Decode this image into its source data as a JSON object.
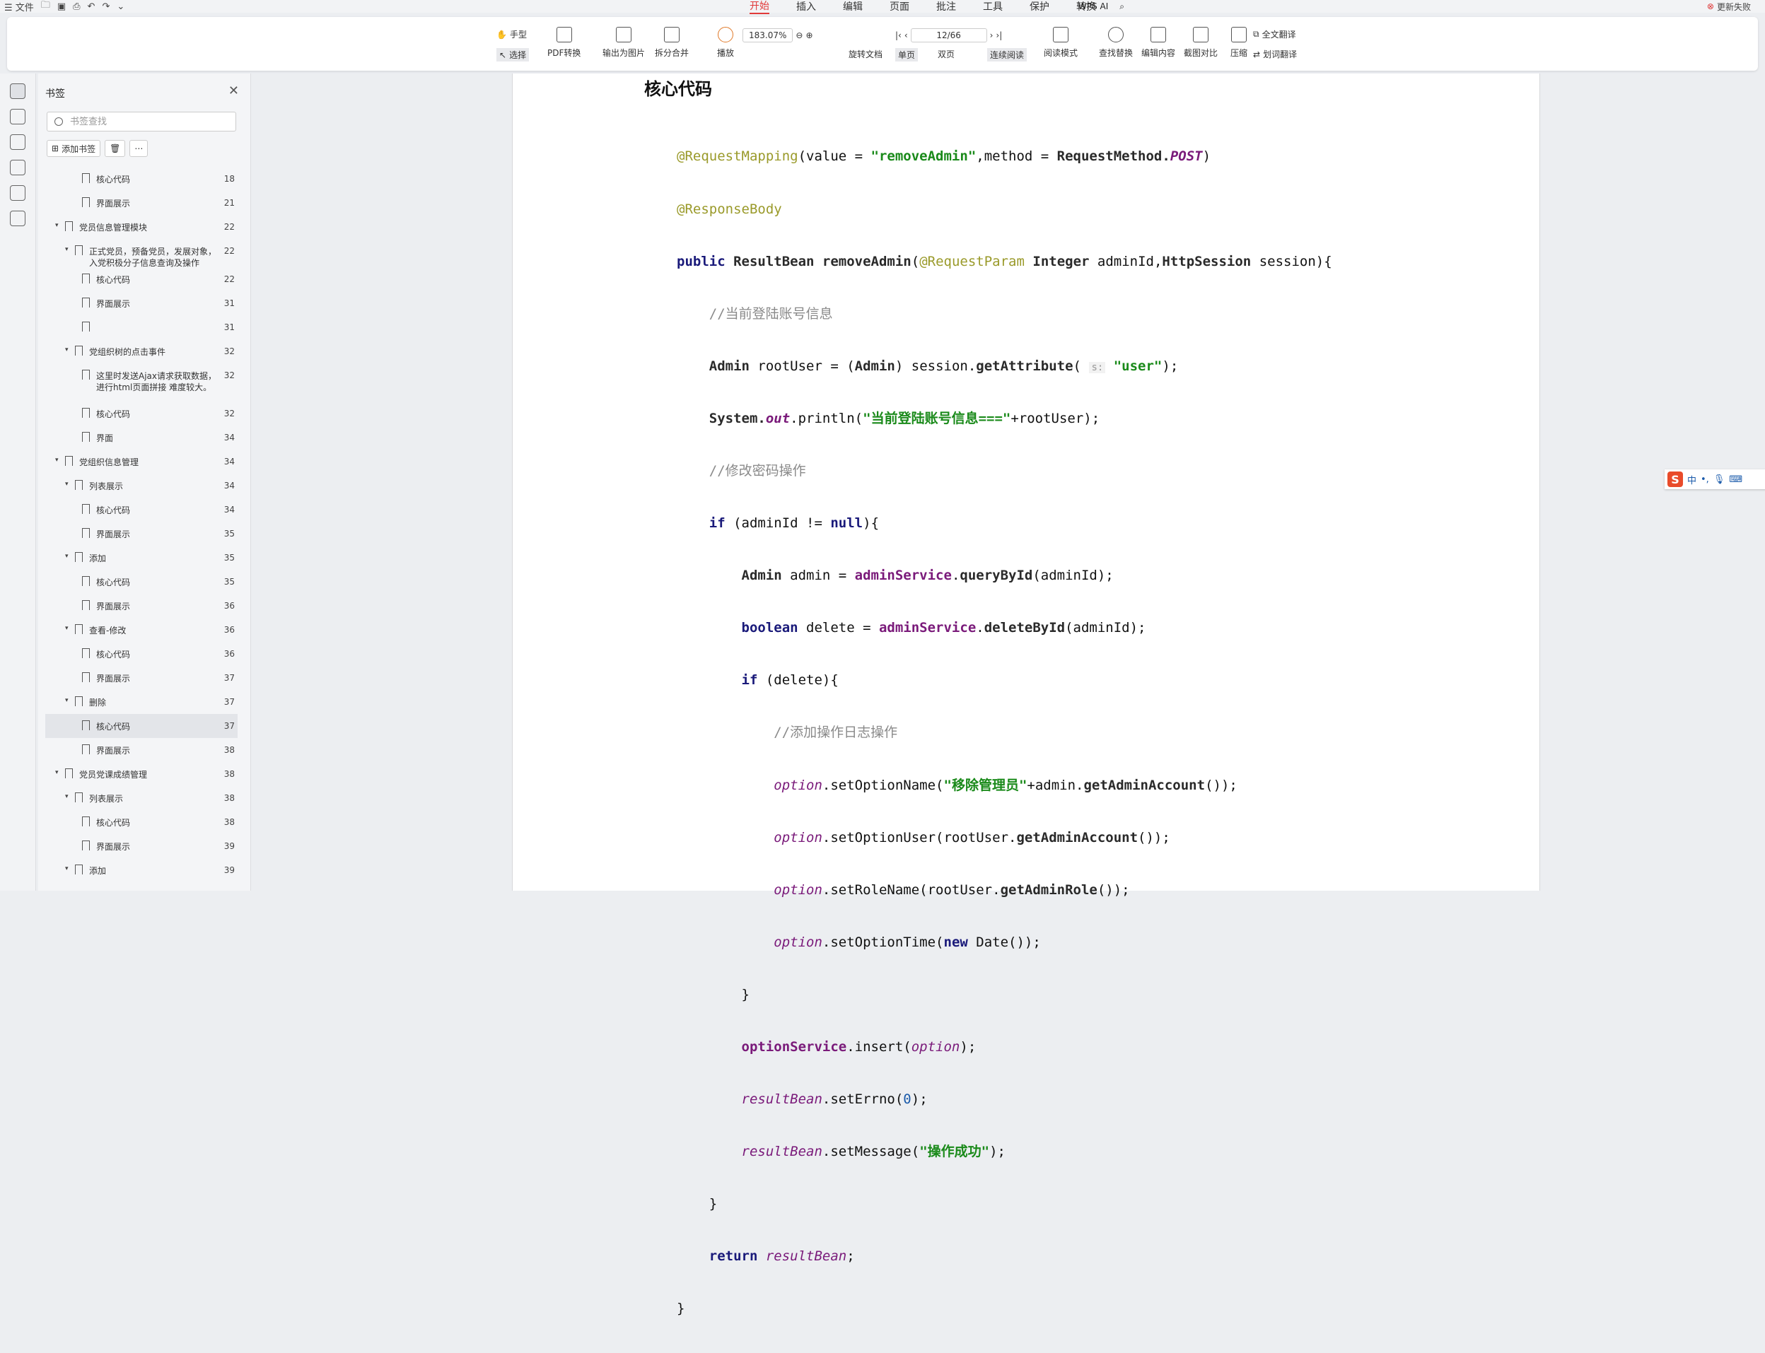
{
  "titlebar": {
    "file_menu": "文件",
    "menus": [
      "开始",
      "插入",
      "编辑",
      "页面",
      "批注",
      "工具",
      "保护",
      "转换"
    ],
    "active_menu": "开始",
    "wps_ai": "WPS AI",
    "update_failed": "更新失败"
  },
  "ribbon": {
    "hand": "手型",
    "select": "选择",
    "pdf_convert": "PDF转换",
    "export_image": "输出为图片",
    "split_merge": "拆分合并",
    "play": "播放",
    "zoom": "183.07%",
    "page_input": "12/66",
    "rotate": "旋转文档",
    "single": "单页",
    "double": "双页",
    "continuous": "连续阅读",
    "read_mode": "阅读模式",
    "find_replace": "查找替换",
    "edit_content": "编辑内容",
    "screenshot_compare": "截图对比",
    "compress": "压缩",
    "full_translate": "全文翻译",
    "word_translate": "划词翻译"
  },
  "sidebar": {
    "title": "书签",
    "search_placeholder": "书签查找",
    "add_bookmark": "添加书签"
  },
  "bookmarks": [
    {
      "label": "核心代码",
      "page": "18",
      "level": 2,
      "expander": false
    },
    {
      "label": "界面展示",
      "page": "21",
      "level": 2,
      "expander": false
    },
    {
      "label": "党员信息管理模块",
      "page": "22",
      "level": 0,
      "expander": true
    },
    {
      "label": "正式党员，预备党员，发展对象，入党积极分子信息查询及操作",
      "page": "22",
      "level": 1,
      "expander": true,
      "lines": 2
    },
    {
      "label": "核心代码",
      "page": "22",
      "level": 2,
      "expander": false
    },
    {
      "label": "界面展示",
      "page": "31",
      "level": 2,
      "expander": false
    },
    {
      "label": "",
      "page": "31",
      "level": 2,
      "expander": false
    },
    {
      "label": "党组织树的点击事件",
      "page": "32",
      "level": 1,
      "expander": true
    },
    {
      "label": "这里时发送Ajax请求获取数据，进行html页面拼接  难度较大。",
      "page": "32",
      "level": 2,
      "expander": false,
      "lines": 3
    },
    {
      "label": "核心代码",
      "page": "32",
      "level": 2,
      "expander": false
    },
    {
      "label": "界面",
      "page": "34",
      "level": 2,
      "expander": false
    },
    {
      "label": "党组织信息管理",
      "page": "34",
      "level": 0,
      "expander": true
    },
    {
      "label": "列表展示",
      "page": "34",
      "level": 1,
      "expander": true
    },
    {
      "label": "核心代码",
      "page": "34",
      "level": 2,
      "expander": false
    },
    {
      "label": "界面展示",
      "page": "35",
      "level": 2,
      "expander": false
    },
    {
      "label": "添加",
      "page": "35",
      "level": 1,
      "expander": true
    },
    {
      "label": "核心代码",
      "page": "35",
      "level": 2,
      "expander": false
    },
    {
      "label": "界面展示",
      "page": "36",
      "level": 2,
      "expander": false
    },
    {
      "label": "查看-修改",
      "page": "36",
      "level": 1,
      "expander": true
    },
    {
      "label": "核心代码",
      "page": "36",
      "level": 2,
      "expander": false
    },
    {
      "label": "界面展示",
      "page": "37",
      "level": 2,
      "expander": false
    },
    {
      "label": "删除",
      "page": "37",
      "level": 1,
      "expander": true
    },
    {
      "label": "核心代码",
      "page": "37",
      "level": 2,
      "expander": false,
      "selected": true
    },
    {
      "label": "界面展示",
      "page": "38",
      "level": 2,
      "expander": false
    },
    {
      "label": "党员党课成绩管理",
      "page": "38",
      "level": 0,
      "expander": true
    },
    {
      "label": "列表展示",
      "page": "38",
      "level": 1,
      "expander": true
    },
    {
      "label": "核心代码",
      "page": "38",
      "level": 2,
      "expander": false
    },
    {
      "label": "界面展示",
      "page": "39",
      "level": 2,
      "expander": false
    },
    {
      "label": "添加",
      "page": "39",
      "level": 1,
      "expander": true
    }
  ],
  "document": {
    "heading": "核心代码",
    "code": {
      "l1_a": "@RequestMapping",
      "l1_b": "(value = ",
      "l1_c": "\"removeAdmin\"",
      "l1_d": ",method = ",
      "l1_e": "RequestMethod.",
      "l1_f": "POST",
      "l1_g": ")",
      "l2": "@ResponseBody",
      "l3_a": "public ",
      "l3_b": "ResultBean ",
      "l3_c": "removeAdmin",
      "l3_d": "(",
      "l3_e": "@RequestParam ",
      "l3_f": "Integer ",
      "l3_g": "adminId,",
      "l3_h": "HttpSession ",
      "l3_i": "session){",
      "l4": "    //当前登陆账号信息",
      "l5_a": "    Admin ",
      "l5_b": "rootUser = (",
      "l5_c": "Admin",
      "l5_d": ") session.",
      "l5_e": "getAttribute",
      "l5_f": "( ",
      "l5_hint": "s:",
      "l5_g": " \"user\"",
      "l5_h": ");",
      "l6_a": "    System.",
      "l6_b": "out",
      "l6_c": ".println(",
      "l6_d": "\"当前登陆账号信息===\"",
      "l6_e": "+rootUser);",
      "l7": "    //修改密码操作",
      "l8_a": "    if ",
      "l8_b": "(adminId != ",
      "l8_c": "null",
      "l8_d": "){",
      "l9_a": "        Admin ",
      "l9_b": "admin = ",
      "l9_c": "adminService",
      "l9_d": ".",
      "l9_e": "queryById",
      "l9_f": "(adminId);",
      "l10_a": "        boolean ",
      "l10_b": "delete = ",
      "l10_c": "adminService",
      "l10_d": ".",
      "l10_e": "deleteById",
      "l10_f": "(adminId);",
      "l11_a": "        if ",
      "l11_b": "(delete){",
      "l12": "            //添加操作日志操作",
      "l13_a": "            option",
      "l13_b": ".setOptionName(",
      "l13_c": "\"移除管理员\"",
      "l13_d": "+admin.",
      "l13_e": "getAdminAccount",
      "l13_f": "());",
      "l14_a": "            option",
      "l14_b": ".setOptionUser(rootUser.",
      "l14_c": "getAdminAccount",
      "l14_d": "());",
      "l15_a": "            option",
      "l15_b": ".setRoleName(rootUser.",
      "l15_c": "getAdminRole",
      "l15_d": "());",
      "l16_a": "            option",
      "l16_b": ".setOptionTime(",
      "l16_c": "new ",
      "l16_d": "Date());",
      "l17": "        }",
      "l18_a": "        optionService",
      "l18_b": ".insert(",
      "l18_c": "option",
      "l18_d": ");",
      "l19_a": "        resultBean",
      "l19_b": ".setErrno(",
      "l19_c": "0",
      "l19_d": ");",
      "l20_a": "        resultBean",
      "l20_b": ".setMessage(",
      "l20_c": "\"操作成功\"",
      "l20_d": ");",
      "l21": "    }",
      "l22_a": "    return ",
      "l22_b": "resultBean",
      "l22_c": ";",
      "l23": "}"
    }
  },
  "ime": {
    "label": "中"
  }
}
